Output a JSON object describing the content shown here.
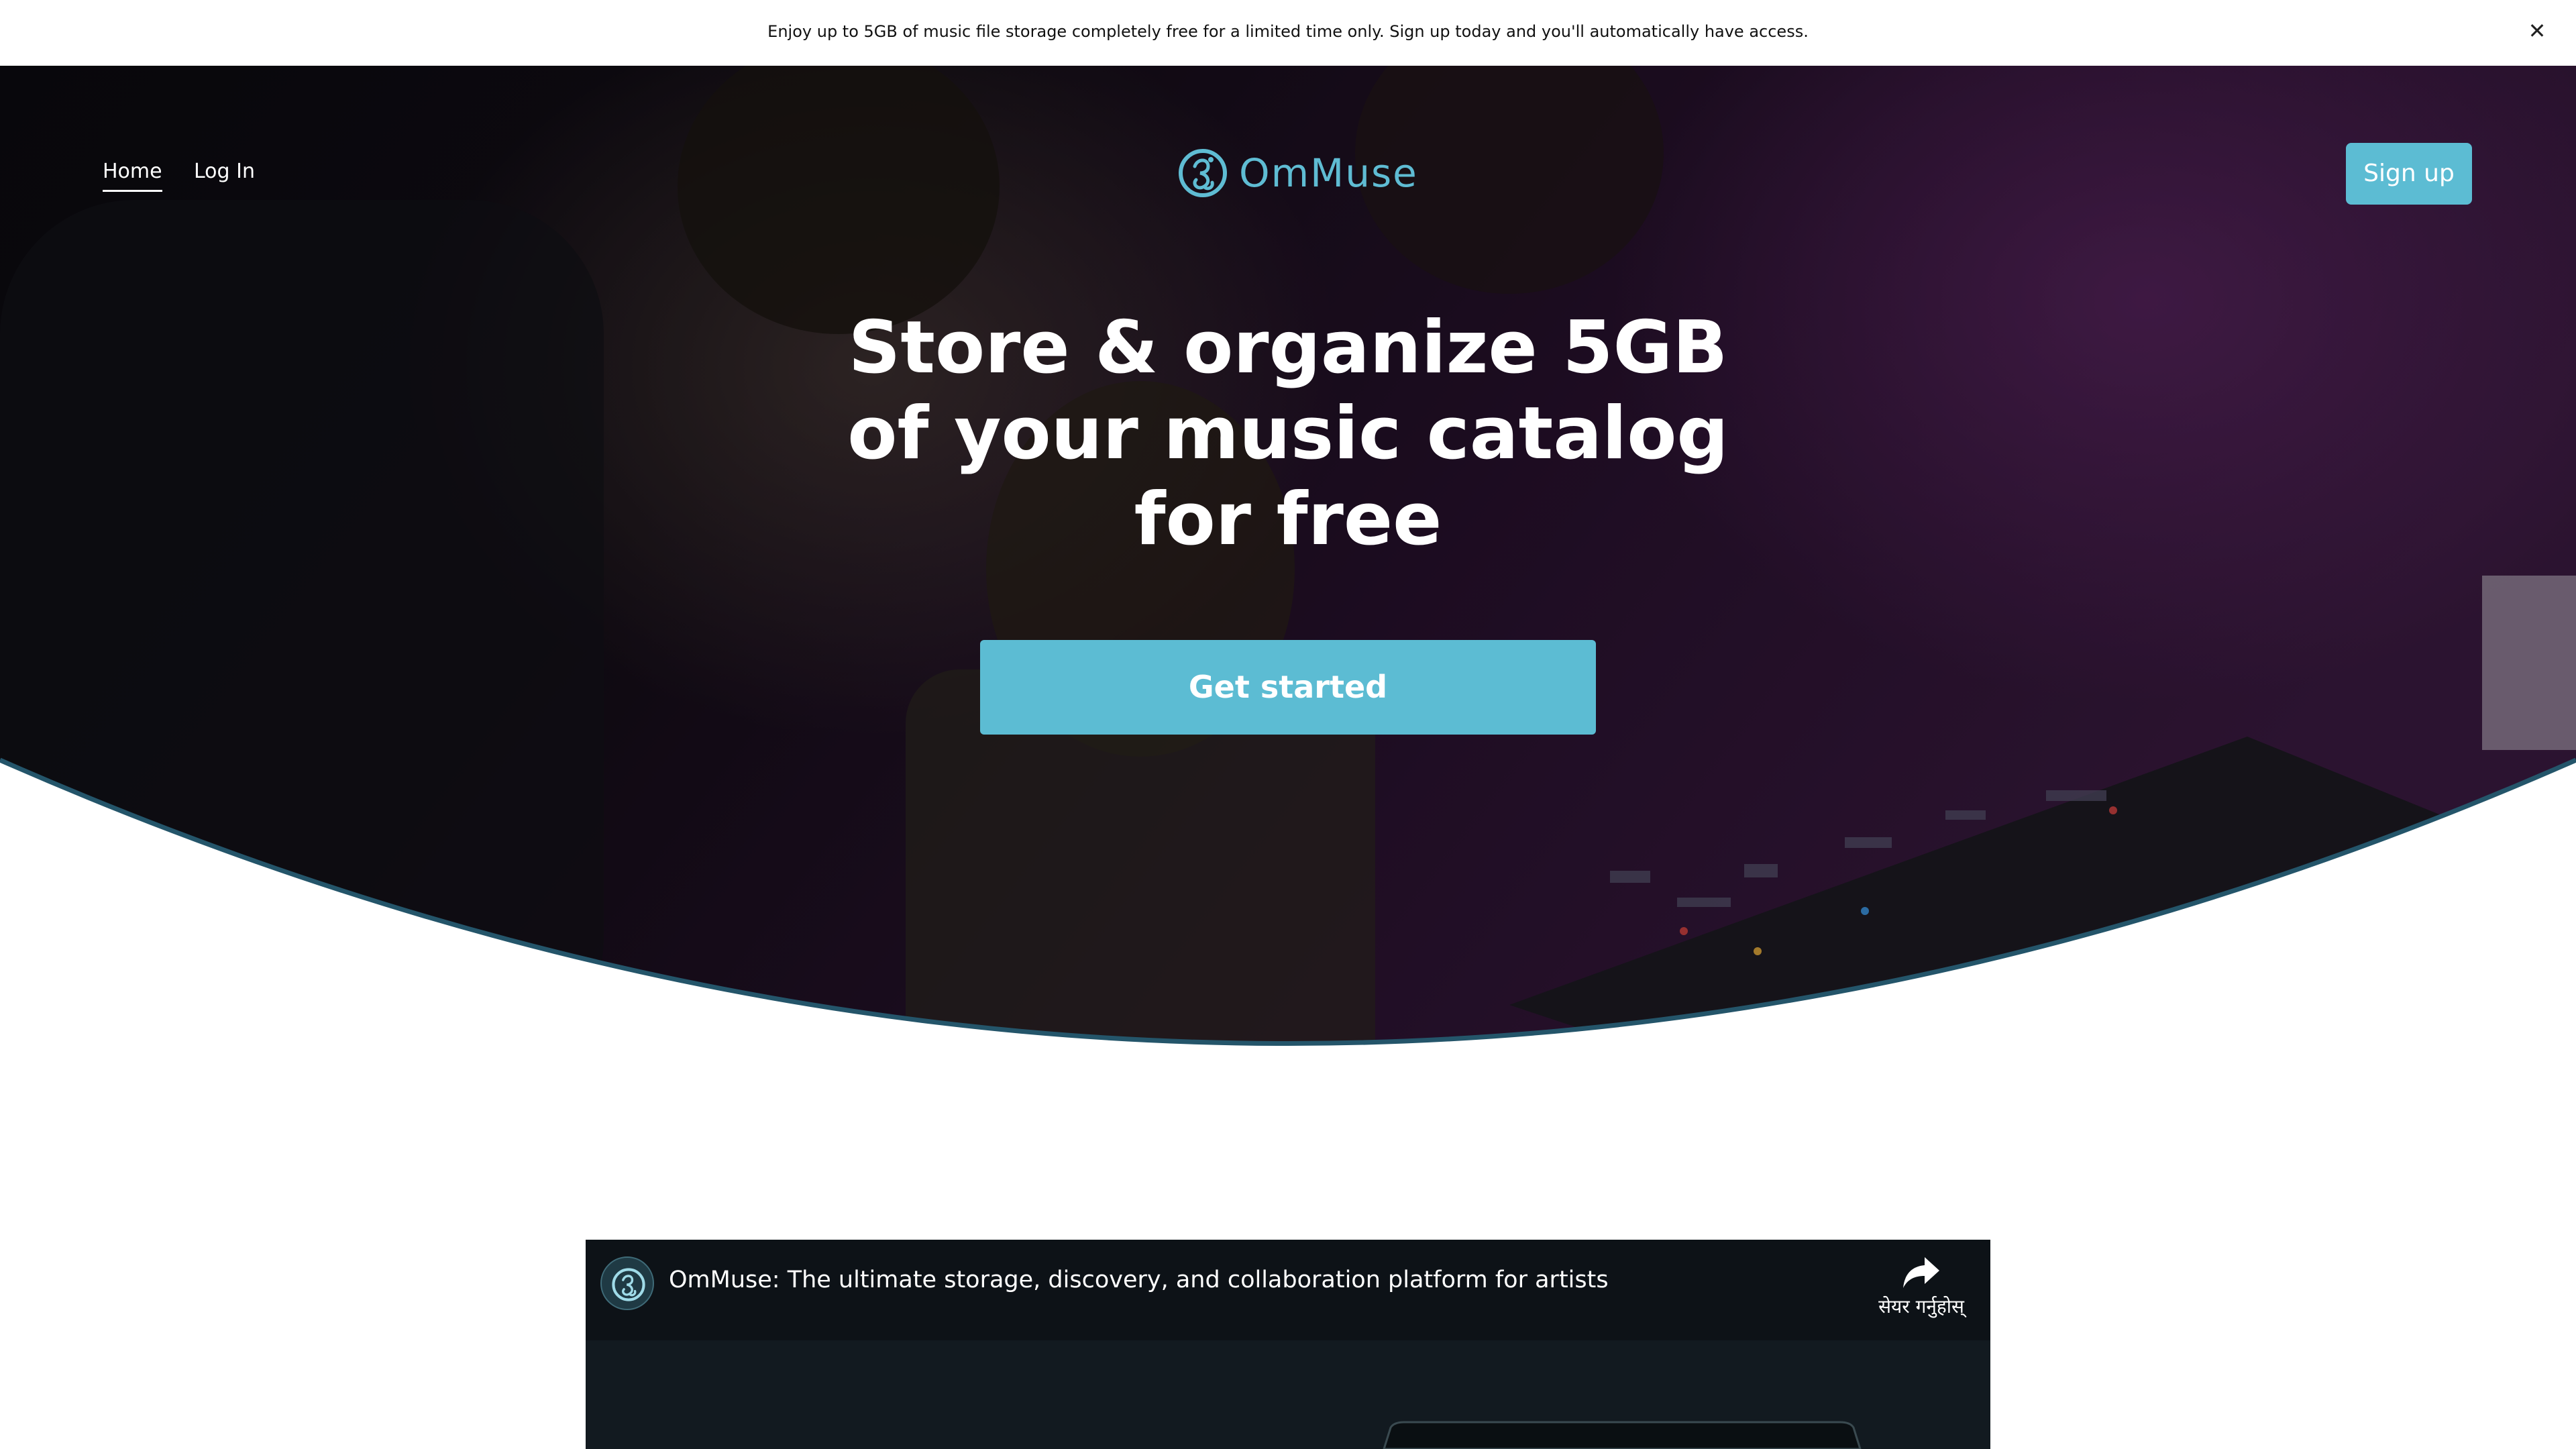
{
  "announcement": {
    "text": "Enjoy up to 5GB of music file storage completely free for a limited time only. Sign up today and you'll automatically have access.",
    "close_icon": "close-icon"
  },
  "nav": {
    "home_label": "Home",
    "login_label": "Log In",
    "active": "Home"
  },
  "brand": {
    "name": "OmMuse",
    "logo_icon": "om-logo-icon",
    "color": "#5fbcd3"
  },
  "header": {
    "signup_label": "Sign up"
  },
  "hero": {
    "title_lines": [
      "Store & organize 5GB",
      "of your music catalog",
      "for free"
    ],
    "cta_label": "Get started"
  },
  "video": {
    "title": "OmMuse: The ultimate storage, discovery, and collaboration platform for artists",
    "share_label": "सेयर गर्नुहोस्",
    "share_icon": "share-icon",
    "channel_icon": "om-logo-icon"
  },
  "colors": {
    "accent": "#5cbcd3",
    "curve_stroke": "#24556a",
    "hero_overlay": "#1a0d1c"
  }
}
